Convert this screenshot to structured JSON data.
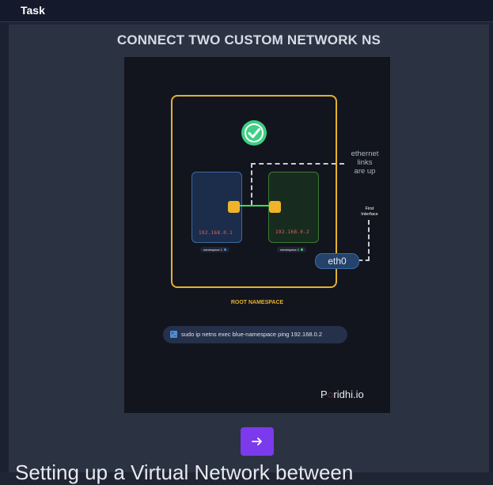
{
  "header": {
    "title": "Task"
  },
  "task": {
    "title": "CONNECT TWO CUSTOM NETWORK NS",
    "next_icon": "arrow-right-icon",
    "section_heading": "Setting up a Virtual Network between"
  },
  "diagram": {
    "annotation_lines": [
      "ethernet",
      "links",
      "are up"
    ],
    "first_interface_lines": [
      "First",
      "Interface"
    ],
    "blue_ns_ip": "192.168.0.1",
    "green_ns_ip": "192.168.0.2",
    "blue_ns_tag": "namespace 1",
    "green_ns_tag": "namespace 2",
    "eth0_label": "eth0",
    "root_label": "ROOT NAMESPACE",
    "command": "sudo ip netns exec blue-namespace ping 192.168.0.2",
    "brand_prefix": "P",
    "brand_suffix": "ridhi.io",
    "status_icon": "check-circle-icon"
  },
  "colors": {
    "accent": "#7c3aed",
    "root_border": "#e4b12d",
    "link": "#3fdb58",
    "check": "#3dcf83"
  }
}
